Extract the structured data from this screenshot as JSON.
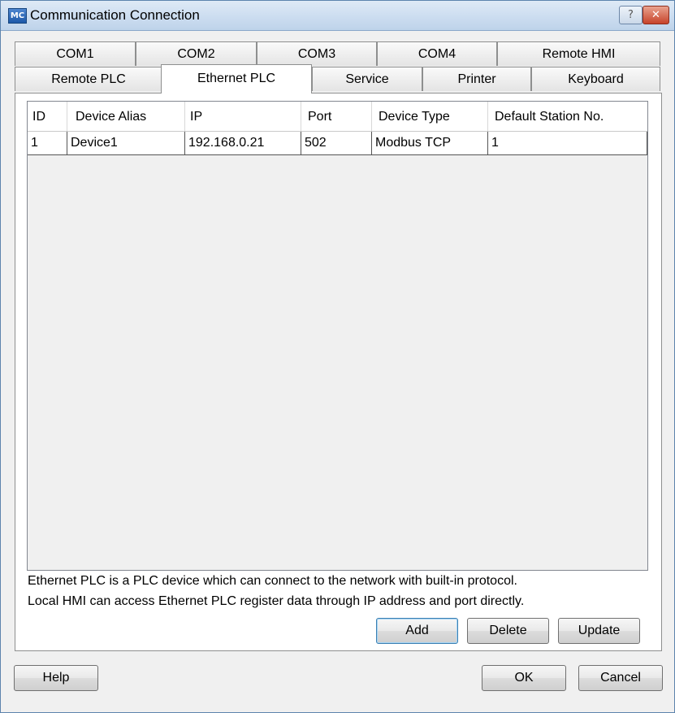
{
  "window": {
    "title": "Communication Connection",
    "icon_label": "MC",
    "help_glyph": "?",
    "close_glyph": "✕"
  },
  "tabs_row1": [
    "COM1",
    "COM2",
    "COM3",
    "COM4",
    "Remote HMI"
  ],
  "tabs_row2": [
    "Remote PLC",
    "Ethernet PLC",
    "Service",
    "Printer",
    "Keyboard"
  ],
  "active_tab": "Ethernet PLC",
  "table": {
    "columns": [
      "ID",
      "Device Alias",
      "IP",
      "Port",
      "Device Type",
      "Default Station No."
    ],
    "rows": [
      [
        "1",
        "Device1",
        "192.168.0.21",
        "502",
        "Modbus TCP",
        "1"
      ]
    ]
  },
  "description": {
    "line1": "Ethernet PLC is a PLC device which can connect to the network with built-in protocol.",
    "line2": "Local HMI can access Ethernet PLC register data through IP address and port directly."
  },
  "buttons": {
    "add": "Add",
    "delete": "Delete",
    "update": "Update",
    "help": "Help",
    "ok": "OK",
    "cancel": "Cancel"
  },
  "colors": {
    "title_bar": "#cfdff1",
    "close_button": "#c7432a",
    "dialog_bg": "#f0f0f0"
  }
}
